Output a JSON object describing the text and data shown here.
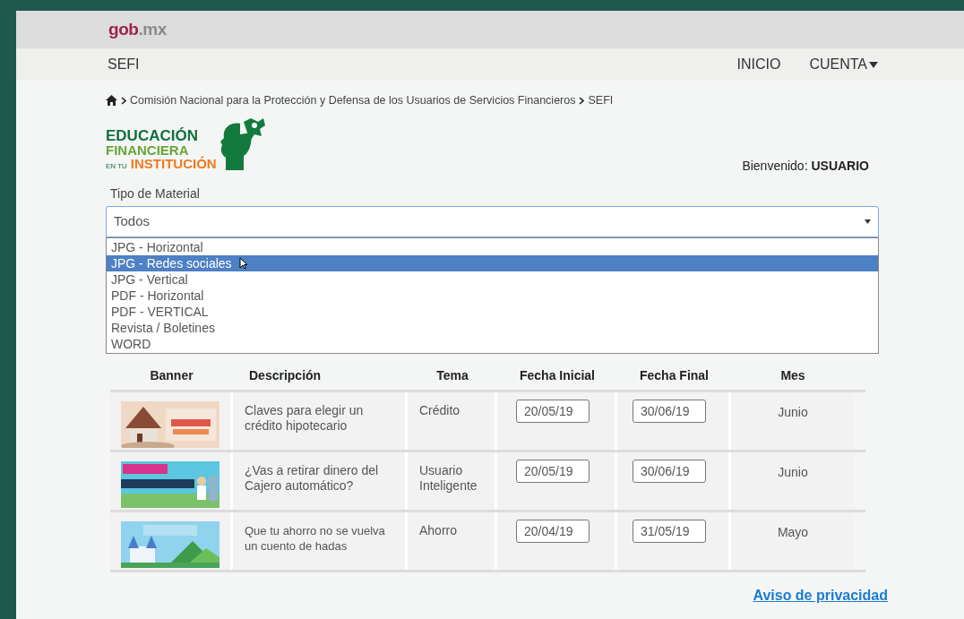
{
  "top_bar": {
    "logo": {
      "main": "gob",
      "suffix": ".mx"
    }
  },
  "nav": {
    "brand": "SEFI",
    "links": [
      {
        "label": "INICIO",
        "kind": "link"
      },
      {
        "label": "CUENTA",
        "kind": "dropdown"
      }
    ]
  },
  "breadcrumb": [
    "Comisión Nacional para la Protección y Defensa de los Usuarios de Servicios Financieros",
    "SEFI"
  ],
  "logo": {
    "line_1": "EDUCACIÓN",
    "line_2": "FINANCIERA",
    "line_3_prefix": "EN TU",
    "line_3": "INSTITUCIÓN"
  },
  "welcome": {
    "label": "Bienvenido:",
    "user": "USUARIO"
  },
  "filter": {
    "label": "Tipo de Material",
    "value": "Todos",
    "expanded": true,
    "options": [
      {
        "label": "JPG - Horizontal",
        "selected": false
      },
      {
        "label": "JPG - Redes sociales",
        "selected": true
      },
      {
        "label": "JPG - Vertical",
        "selected": false
      },
      {
        "label": "PDF - Horizontal",
        "selected": false
      },
      {
        "label": "PDF - VERTICAL",
        "selected": false
      },
      {
        "label": "Revista / Boletines",
        "selected": false
      },
      {
        "label": "WORD",
        "selected": false
      }
    ]
  },
  "table": {
    "columns": [
      "Banner",
      "Descripción",
      "Tema",
      "Fecha Inicial",
      "Fecha Final",
      "Mes"
    ],
    "rows": [
      {
        "description": "Claves para elegir un crédito hipotecario",
        "topic": "Crédito",
        "start": "20/05/19",
        "end": "30/06/19",
        "month": "Junio"
      },
      {
        "description": "¿Vas a retirar dinero del Cajero automático?",
        "topic": "Usuario Inteligente",
        "start": "20/05/19",
        "end": "30/06/19",
        "month": "Junio"
      },
      {
        "description": "Que tu ahorro no se vuelva un cuento de hadas",
        "topic": "Ahorro",
        "start": "20/04/19",
        "end": "31/05/19",
        "month": "Mayo"
      }
    ]
  },
  "footer": {
    "link": "Aviso de privacidad"
  }
}
